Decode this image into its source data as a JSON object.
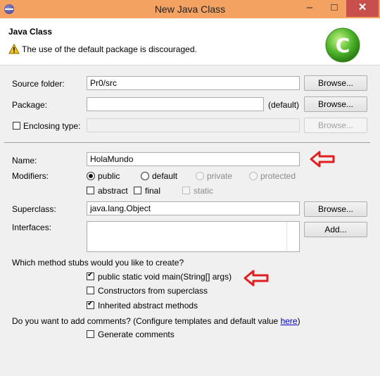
{
  "window": {
    "title": "New Java Class",
    "min_glyph": "–",
    "max_glyph": "□",
    "close_glyph": "✕"
  },
  "header": {
    "title": "Java Class",
    "message": "The use of the default package is discouraged."
  },
  "source_folder": {
    "label": "Source folder:",
    "value": "Pr0/src",
    "browse": "Browse..."
  },
  "package": {
    "label": "Package:",
    "value": "",
    "suffix": "(default)",
    "browse": "Browse..."
  },
  "enclosing": {
    "label": "Enclosing type:",
    "checked": false,
    "value": "",
    "browse": "Browse..."
  },
  "name": {
    "label": "Name:",
    "value": "HolaMundo"
  },
  "modifiers": {
    "label": "Modifiers:",
    "public": "public",
    "default": "default",
    "private": "private",
    "protected": "protected",
    "abstract": "abstract",
    "final": "final",
    "static": "static",
    "selected": "public"
  },
  "superclass": {
    "label": "Superclass:",
    "value": "java.lang.Object",
    "browse": "Browse..."
  },
  "interfaces": {
    "label": "Interfaces:",
    "add": "Add..."
  },
  "stubs": {
    "question": "Which method stubs would you like to create?",
    "main": "public static void main(String[] args)",
    "constructors": "Constructors from superclass",
    "inherited": "Inherited abstract methods",
    "main_checked": true,
    "constructors_checked": false,
    "inherited_checked": true
  },
  "comments": {
    "question": "Do you want to add comments? (Configure templates and default value ",
    "link": "here",
    "question_end": ")",
    "generate": "Generate comments",
    "generate_checked": false
  },
  "colors": {
    "titlebar": "#f3a261",
    "close": "#c7504c",
    "annotation_arrow": "#e02020",
    "link": "#0000cc"
  },
  "icons": {
    "app": "eclipse-icon",
    "warning": "warning-icon",
    "logo": "java-class-logo-icon",
    "annotation": "red-arrow-icon"
  }
}
